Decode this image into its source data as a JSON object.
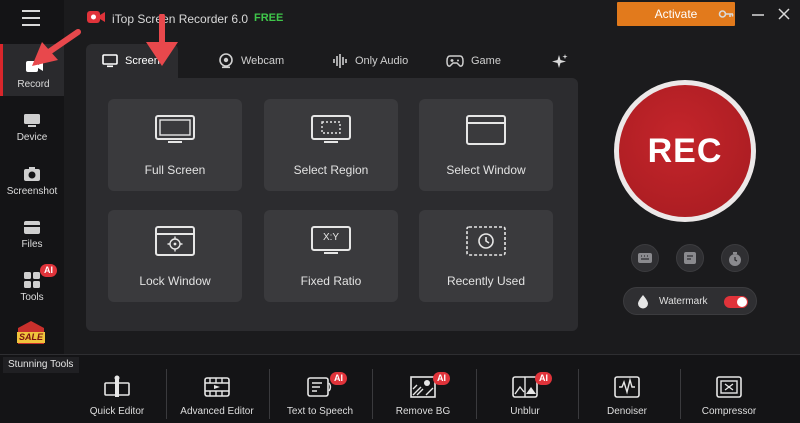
{
  "app": {
    "title": "iTop Screen Recorder 6.0",
    "free_badge": "FREE",
    "activate_label": "Activate"
  },
  "sidebar": {
    "items": [
      {
        "label": "Record",
        "icon": "record-icon",
        "active": true
      },
      {
        "label": "Device",
        "icon": "device-icon"
      },
      {
        "label": "Screenshot",
        "icon": "camera-icon"
      },
      {
        "label": "Files",
        "icon": "folder-icon"
      },
      {
        "label": "Tools",
        "icon": "tools-icon",
        "badge": "AI"
      }
    ],
    "sale_label": "SALE"
  },
  "tabs": [
    {
      "label": "Screen",
      "icon": "monitor-icon"
    },
    {
      "label": "Webcam",
      "icon": "webcam-icon"
    },
    {
      "label": "Only Audio",
      "icon": "audio-wave-icon"
    },
    {
      "label": "Game",
      "icon": "gamepad-icon"
    }
  ],
  "modes": [
    {
      "label": "Full Screen",
      "icon": "full-screen-icon"
    },
    {
      "label": "Select Region",
      "icon": "select-region-icon"
    },
    {
      "label": "Select Window",
      "icon": "select-window-icon"
    },
    {
      "label": "Lock Window",
      "icon": "lock-window-icon"
    },
    {
      "label": "Fixed Ratio",
      "icon": "fixed-ratio-icon",
      "icon_text": "X:Y"
    },
    {
      "label": "Recently Used",
      "icon": "recently-used-icon"
    }
  ],
  "rec": {
    "label": "REC"
  },
  "watermark": {
    "label": "Watermark",
    "enabled": true
  },
  "bottom": {
    "section_label": "Stunning Tools",
    "ai_badge": "AI",
    "tools": [
      {
        "label": "Quick Editor",
        "icon": "quick-editor-icon"
      },
      {
        "label": "Advanced Editor",
        "icon": "advanced-editor-icon"
      },
      {
        "label": "Text to Speech",
        "icon": "text-to-speech-icon",
        "ai": true
      },
      {
        "label": "Remove BG",
        "icon": "remove-bg-icon",
        "ai": true
      },
      {
        "label": "Unblur",
        "icon": "unblur-icon",
        "ai": true
      },
      {
        "label": "Denoiser",
        "icon": "denoiser-icon"
      },
      {
        "label": "Compressor",
        "icon": "compressor-icon"
      }
    ]
  },
  "colors": {
    "accent_red": "#d8262b",
    "activate_orange": "#e27a1c",
    "free_green": "#3fc64a"
  }
}
